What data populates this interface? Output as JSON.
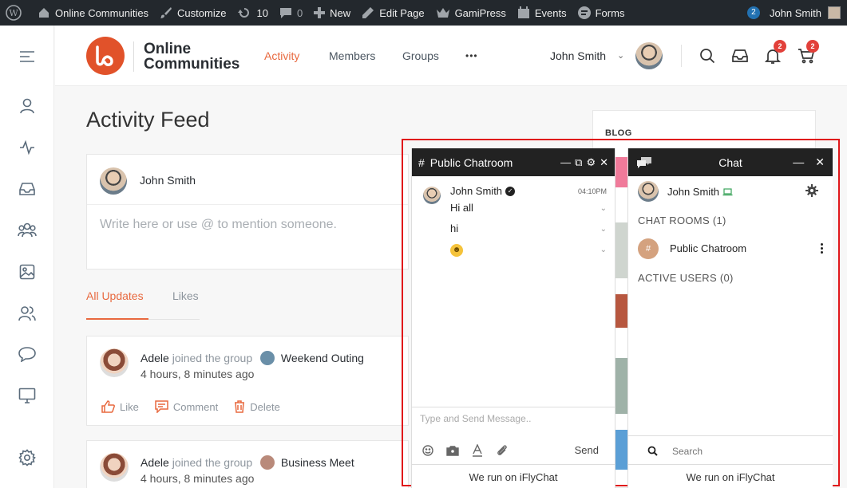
{
  "wpbar": {
    "site": "Online Communities",
    "customize": "Customize",
    "updates": "10",
    "comments": "0",
    "new": "New",
    "edit_page": "Edit Page",
    "gamipress": "GamiPress",
    "events": "Events",
    "forms": "Forms",
    "notif_count": "2",
    "user": "John Smith"
  },
  "header": {
    "logo_line1": "Online",
    "logo_line2": "Communities",
    "nav": [
      "Activity",
      "Members",
      "Groups",
      "•••"
    ],
    "user_name": "John Smith",
    "messages_badge": "2",
    "cart_badge": "2"
  },
  "feed": {
    "title": "Activity Feed",
    "composer_user": "John Smith",
    "composer_placeholder": "Write here or use @ to mention someone.",
    "tabs": [
      "All Updates",
      "Likes"
    ],
    "items": [
      {
        "user": "Adele",
        "action": "joined the group",
        "group": "Weekend Outing",
        "time": "4 hours, 8 minutes ago",
        "like": "Like",
        "comment": "Comment",
        "delete": "Delete"
      },
      {
        "user": "Adele",
        "action": "joined the group",
        "group": "Business Meet",
        "time": "4 hours, 8 minutes ago"
      }
    ]
  },
  "blog": {
    "label": "BLOG"
  },
  "chatroom": {
    "title": "Public Chatroom",
    "hash": "#",
    "sender": "John Smith",
    "time": "04:10PM",
    "messages": [
      "Hi all",
      "hi"
    ],
    "input_placeholder": "Type and Send Message..",
    "send": "Send",
    "footer": "We run on iFlyChat"
  },
  "chatlist": {
    "title": "Chat",
    "user": "John Smith",
    "rooms_label": "CHAT ROOMS (1)",
    "room_name": "Public Chatroom",
    "room_badge": "#",
    "active_label": "ACTIVE USERS (0)",
    "search_placeholder": "Search",
    "footer": "We run on iFlyChat"
  },
  "colors": {
    "accent": "#e8693f",
    "logo": "#e1522a",
    "highlight": "#e0171a",
    "admin_bar": "#23282d"
  }
}
